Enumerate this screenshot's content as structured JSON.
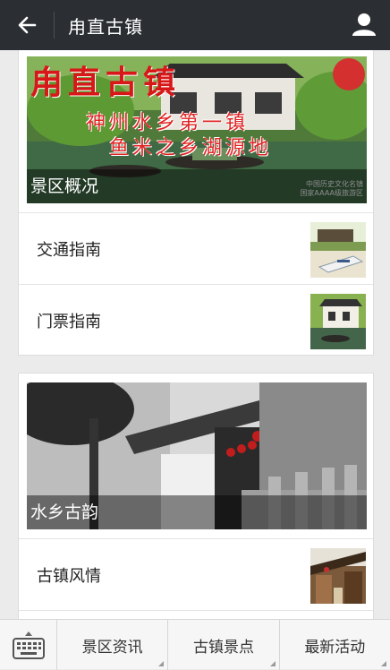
{
  "header": {
    "title": "甪直古镇"
  },
  "card1": {
    "banner": {
      "calligraphy": "甪直古镇",
      "slogan1": "神州水乡第一镇",
      "slogan2": "鱼米之乡湖源地",
      "badge_line1": "中国历史文化名镇",
      "badge_line2": "国家AAAA级旅游区",
      "caption": "景区概况"
    },
    "items": [
      {
        "label": "交通指南"
      },
      {
        "label": "门票指南"
      }
    ]
  },
  "card2": {
    "banner": {
      "caption": "水乡古韵"
    },
    "items": [
      {
        "label": "古镇风情"
      }
    ]
  },
  "bottom_menu": {
    "items": [
      {
        "label": "景区资讯"
      },
      {
        "label": "古镇景点"
      },
      {
        "label": "最新活动"
      }
    ]
  },
  "colors": {
    "topbar": "#2b2f34",
    "background": "#ebebeb"
  },
  "icons": {
    "back": "arrow-left-icon",
    "profile": "user-icon",
    "keyboard": "keyboard-icon"
  }
}
